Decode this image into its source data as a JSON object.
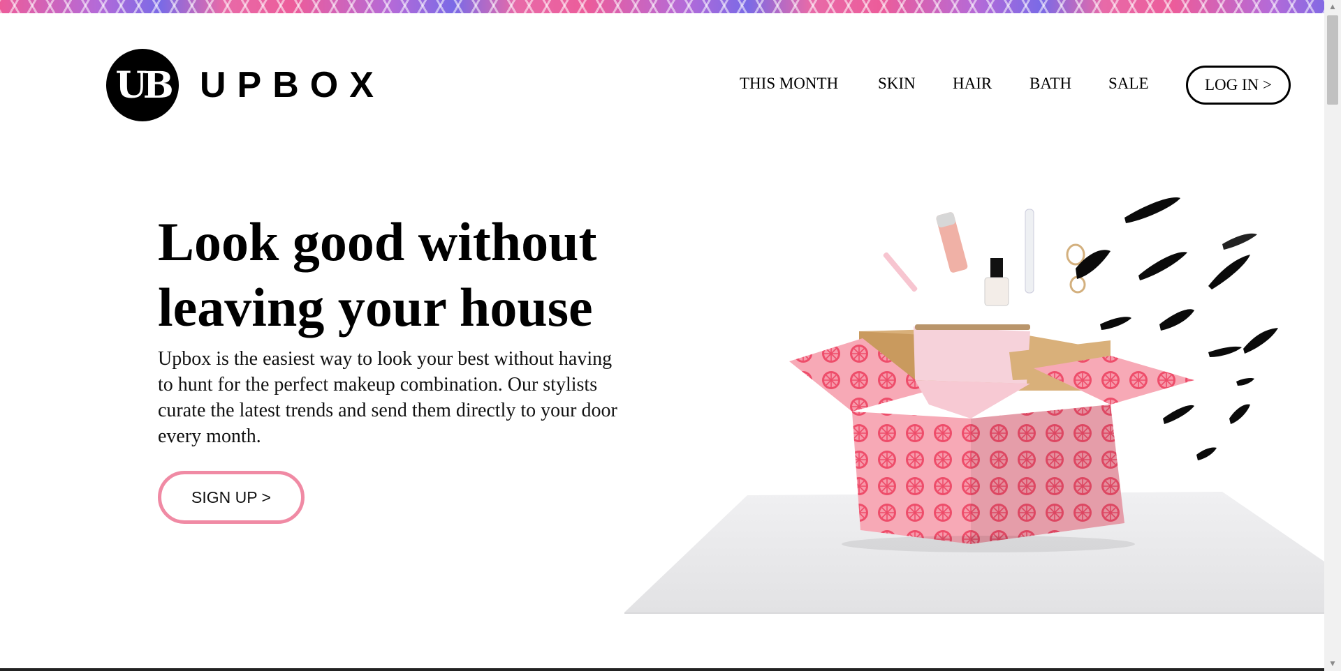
{
  "brand": {
    "name": "UPBOX",
    "mark": "UB"
  },
  "nav": {
    "items": [
      "THIS MONTH",
      "SKIN",
      "HAIR",
      "BATH",
      "SALE"
    ],
    "login_label": "LOG IN >"
  },
  "hero": {
    "title_line1": "Look good without",
    "title_line2": "leaving your house",
    "description": "Upbox is the easiest way to look your best without having to hunt for the perfect makeup combination. Our stylists curate the latest trends and send them directly to your door every month.",
    "signup_label": "SIGN UP >"
  },
  "colors": {
    "accent_pink": "#f08aa4",
    "box_pink": "#f5a3b2",
    "citrus_red": "#ef4f6b",
    "text": "#000000"
  },
  "icons": {
    "scroll_up": "chevron-up-icon",
    "scroll_down": "chevron-down-icon"
  }
}
